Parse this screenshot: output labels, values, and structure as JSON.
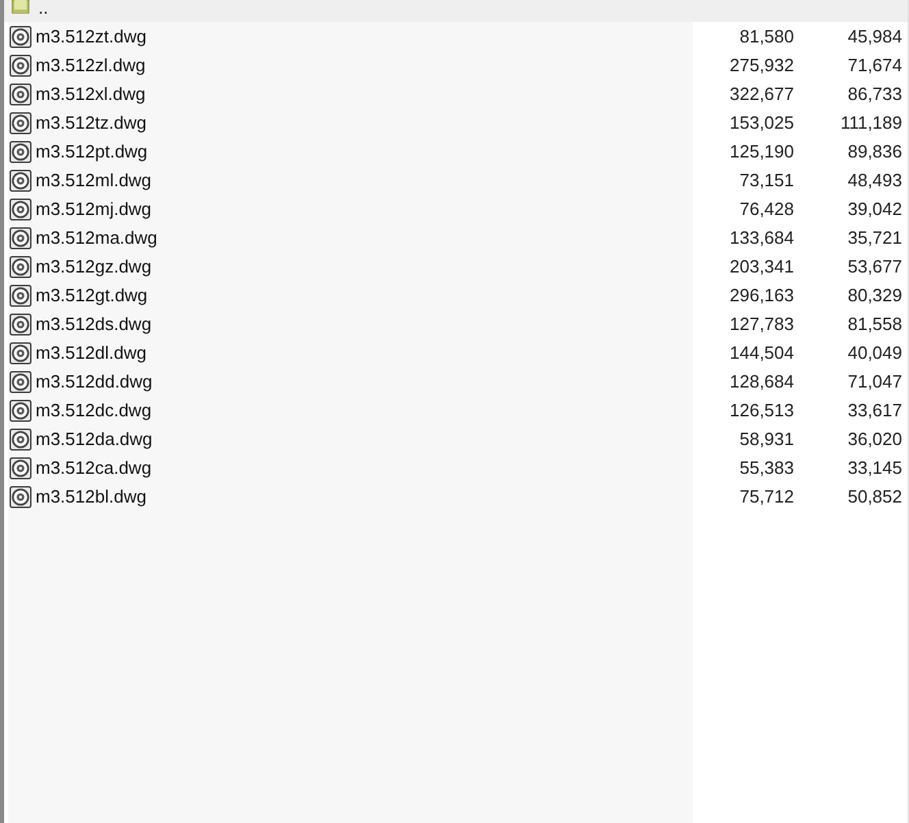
{
  "rows": [
    {
      "kind": "folder",
      "name": "..",
      "selected": true
    },
    {
      "kind": "file",
      "name": "m3.512zt.dwg",
      "column_2": "81,580",
      "column_3": "45,984",
      "selected": false
    },
    {
      "kind": "file",
      "name": "m3.512zl.dwg",
      "column_2": "275,932",
      "column_3": "71,674",
      "selected": false
    },
    {
      "kind": "file",
      "name": "m3.512xl.dwg",
      "column_2": "322,677",
      "column_3": "86,733",
      "selected": false
    },
    {
      "kind": "file",
      "name": "m3.512tz.dwg",
      "column_2": "153,025",
      "column_3": "111,189",
      "selected": false
    },
    {
      "kind": "file",
      "name": "m3.512pt.dwg",
      "column_2": "125,190",
      "column_3": "89,836",
      "selected": false
    },
    {
      "kind": "file",
      "name": "m3.512ml.dwg",
      "column_2": "73,151",
      "column_3": "48,493",
      "selected": false
    },
    {
      "kind": "file",
      "name": "m3.512mj.dwg",
      "column_2": "76,428",
      "column_3": "39,042",
      "selected": false
    },
    {
      "kind": "file",
      "name": "m3.512ma.dwg",
      "column_2": "133,684",
      "column_3": "35,721",
      "selected": false
    },
    {
      "kind": "file",
      "name": "m3.512gz.dwg",
      "column_2": "203,341",
      "column_3": "53,677",
      "selected": false
    },
    {
      "kind": "file",
      "name": "m3.512gt.dwg",
      "column_2": "296,163",
      "column_3": "80,329",
      "selected": false
    },
    {
      "kind": "file",
      "name": "m3.512ds.dwg",
      "column_2": "127,783",
      "column_3": "81,558",
      "selected": false
    },
    {
      "kind": "file",
      "name": "m3.512dl.dwg",
      "column_2": "144,504",
      "column_3": "40,049",
      "selected": false
    },
    {
      "kind": "file",
      "name": "m3.512dd.dwg",
      "column_2": "128,684",
      "column_3": "71,047",
      "selected": false
    },
    {
      "kind": "file",
      "name": "m3.512dc.dwg",
      "column_2": "126,513",
      "column_3": "33,617",
      "selected": false
    },
    {
      "kind": "file",
      "name": "m3.512da.dwg",
      "column_2": "58,931",
      "column_3": "36,020",
      "selected": false
    },
    {
      "kind": "file",
      "name": "m3.512ca.dwg",
      "column_2": "55,383",
      "column_3": "33,145",
      "selected": false
    },
    {
      "kind": "file",
      "name": "m3.512bl.dwg",
      "column_2": "75,712",
      "column_3": "50,852",
      "selected": false
    }
  ]
}
